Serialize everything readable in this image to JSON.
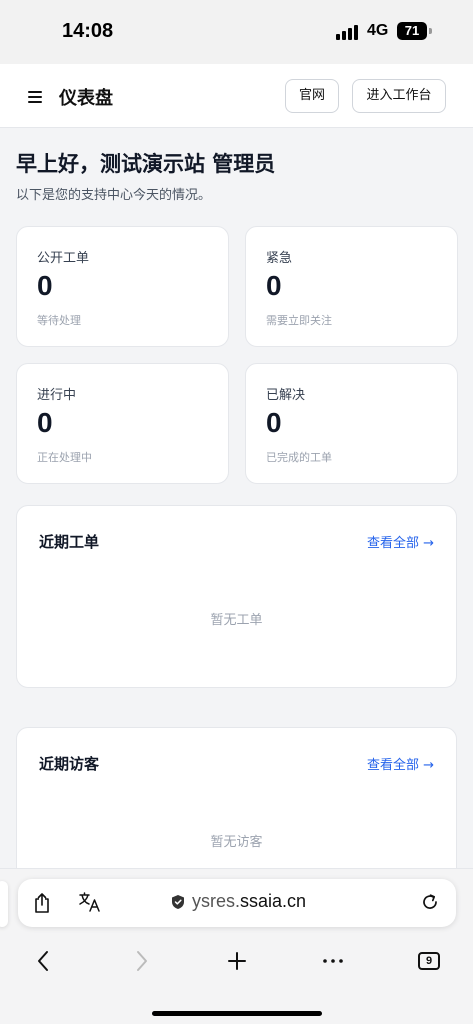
{
  "status_bar": {
    "time": "14:08",
    "network": "4G",
    "battery": "71"
  },
  "header": {
    "title": "仪表盘",
    "official_site_label": "官网",
    "workbench_label": "进入工作台"
  },
  "greeting": {
    "title": "早上好，测试演示站 管理员",
    "subtitle": "以下是您的支持中心今天的情况。"
  },
  "stats": [
    {
      "label": "公开工单",
      "value": "0",
      "desc": "等待处理"
    },
    {
      "label": "紧急",
      "value": "0",
      "desc": "需要立即关注"
    },
    {
      "label": "进行中",
      "value": "0",
      "desc": "正在处理中"
    },
    {
      "label": "已解决",
      "value": "0",
      "desc": "已完成的工单"
    }
  ],
  "recent_tickets": {
    "title": "近期工单",
    "view_all": "查看全部 →",
    "empty": "暂无工单"
  },
  "recent_visitors": {
    "title": "近期访客",
    "view_all": "查看全部 →",
    "empty": "暂无访客"
  },
  "browser": {
    "url_prefix": "ysres.",
    "url_domain": "ssaia.cn",
    "tab_count": "9"
  }
}
